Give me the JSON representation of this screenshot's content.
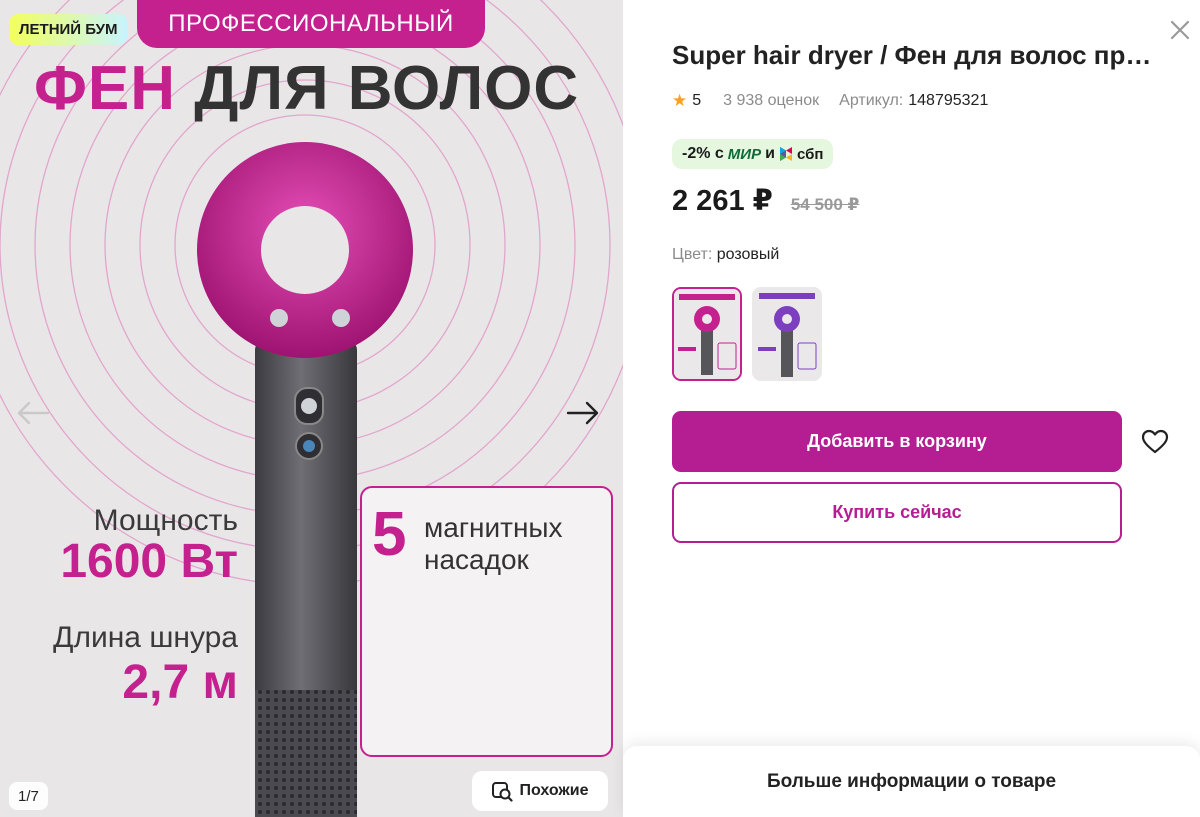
{
  "gallery": {
    "badge": "ЛЕТНИЙ БУМ",
    "banner": "ПРОФЕССИОНАЛЬНЫЙ",
    "title_accent": "ФЕН",
    "title_rest": "ДЛЯ ВОЛОС",
    "power_label": "Мощность",
    "power_value": "1600 Вт",
    "cord_label": "Длина шнура",
    "cord_value": "2,7 м",
    "nozzles_count": "5",
    "nozzles_line1": "магнитных",
    "nozzles_line2": "насадок",
    "counter": "1/7",
    "similar_label": "Похожие",
    "icons": {
      "prev": "arrow-left-icon",
      "next": "arrow-right-icon",
      "similar": "image-search-icon"
    }
  },
  "product": {
    "title": "Super hair dryer / Фен для волос профессиональный",
    "rating": "5",
    "reviews": "3 938 оценок",
    "sku_label": "Артикул:",
    "sku": "148795321",
    "promo_prefix": "-2% с",
    "promo_mir": "МИР",
    "promo_and": "и",
    "promo_sbp": "сбп",
    "price": "2 261 ₽",
    "old_price": "54 500 ₽",
    "color_label": "Цвет:",
    "color_value": "розовый",
    "variants": [
      {
        "color": "pink",
        "accent": "#c4218f",
        "selected": true
      },
      {
        "color": "purple",
        "accent": "#7b3fbf",
        "selected": false
      }
    ],
    "add_to_cart": "Добавить в корзину",
    "buy_now": "Купить сейчас",
    "more_info": "Больше информации о товаре"
  },
  "colors": {
    "brand": "#b51e93",
    "accent_pink": "#c4218f",
    "star": "#ff9f1a",
    "promo_bg": "#e6f7e0"
  }
}
